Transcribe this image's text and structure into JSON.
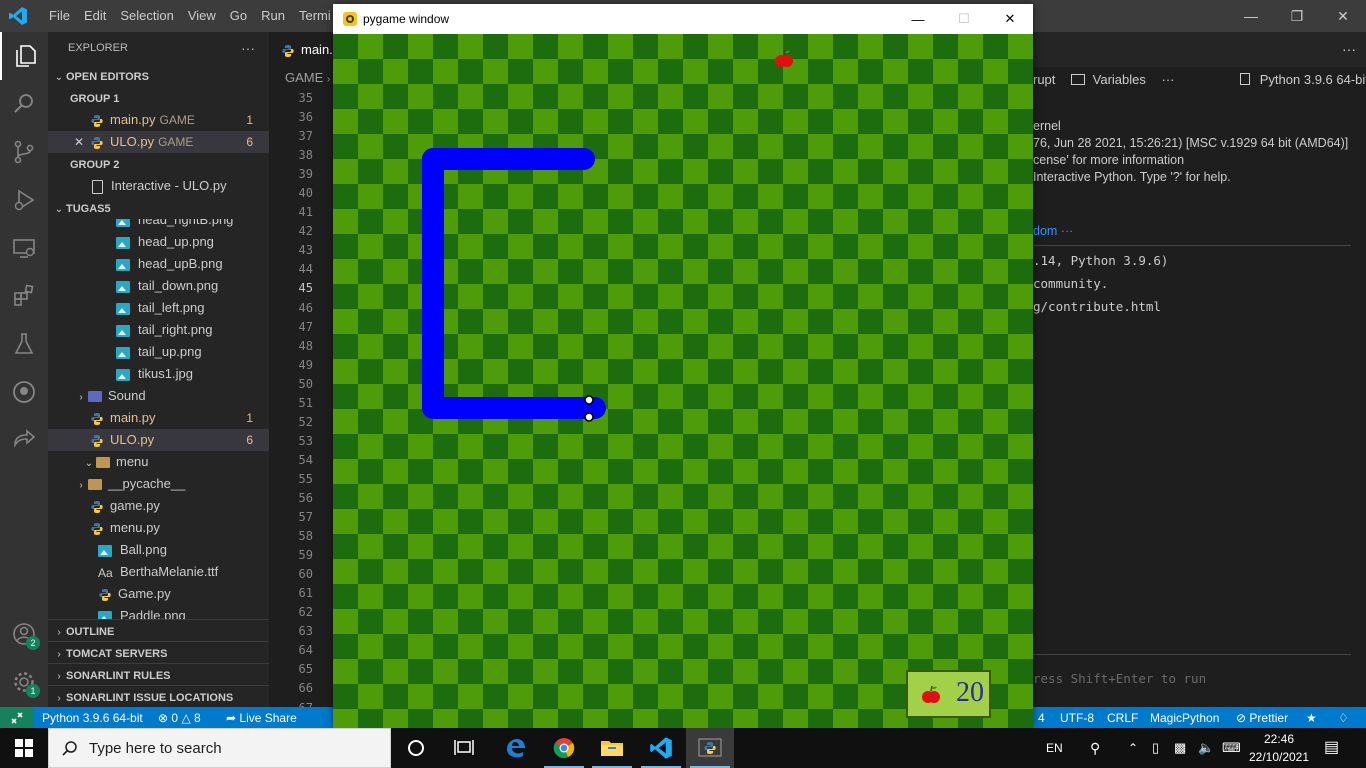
{
  "vscode": {
    "menu": [
      "File",
      "Edit",
      "Selection",
      "View",
      "Go",
      "Run",
      "Termi"
    ],
    "explorer_title": "EXPLORER",
    "open_editors": "OPEN EDITORS",
    "group1": "GROUP 1",
    "group2": "GROUP 2",
    "open_files": [
      {
        "name": "main.py",
        "desc": "GAME",
        "count": "1"
      },
      {
        "name": "ULO.py",
        "desc": "GAME",
        "count": "6"
      }
    ],
    "group2_file": "Interactive - ULO.py",
    "workspace": "TUGAS5",
    "tree": [
      {
        "name": "head_rightB.png",
        "type": "image",
        "indent": 1
      },
      {
        "name": "head_up.png",
        "type": "image",
        "indent": 1
      },
      {
        "name": "head_upB.png",
        "type": "image",
        "indent": 1
      },
      {
        "name": "tail_down.png",
        "type": "image",
        "indent": 1
      },
      {
        "name": "tail_left.png",
        "type": "image",
        "indent": 1
      },
      {
        "name": "tail_right.png",
        "type": "image",
        "indent": 1
      },
      {
        "name": "tail_up.png",
        "type": "image",
        "indent": 1
      },
      {
        "name": "tikus1.jpg",
        "type": "image",
        "indent": 1
      },
      {
        "name": "Sound",
        "type": "folder-closed",
        "indent": 0
      },
      {
        "name": "main.py",
        "type": "py",
        "indent": 0,
        "count": "1",
        "modified": true
      },
      {
        "name": "ULO.py",
        "type": "py",
        "indent": 0,
        "count": "6",
        "modified": true,
        "selected": true
      },
      {
        "name": "menu",
        "type": "folder-open",
        "indent": -1
      },
      {
        "name": "__pycache__",
        "type": "folder-closed",
        "indent": 0
      },
      {
        "name": "game.py",
        "type": "py",
        "indent": 0
      },
      {
        "name": "menu.py",
        "type": "py",
        "indent": 0
      },
      {
        "name": "Ball.png",
        "type": "image",
        "indent": -1
      },
      {
        "name": "BerthaMelanie.ttf",
        "type": "font",
        "indent": -1
      },
      {
        "name": "Game.py",
        "type": "py",
        "indent": -1
      },
      {
        "name": "Paddle.png",
        "type": "image",
        "indent": -1
      }
    ],
    "sections": [
      "OUTLINE",
      "TOMCAT SERVERS",
      "SONARLINT RULES",
      "SONARLINT ISSUE LOCATIONS"
    ],
    "tab_label": "main.",
    "breadcrumb": "GAME",
    "line_numbers": [
      "35",
      "36",
      "37",
      "38",
      "39",
      "40",
      "41",
      "42",
      "43",
      "44",
      "45",
      "46",
      "47",
      "48",
      "49",
      "50",
      "51",
      "52",
      "53",
      "54",
      "55",
      "56",
      "57",
      "58",
      "59",
      "60",
      "61",
      "62",
      "63",
      "64",
      "65",
      "66",
      "67"
    ],
    "current_line": "45",
    "right_panel": {
      "interrupt": "rupt",
      "variables": "Variables",
      "more": "···",
      "kernel": "Python 3.9.6 64-bit",
      "lines": [
        "ernel",
        "76, Jun 28 2021, 15:26:21) [MSC v.1929 64 bit (AMD64)]",
        "cense' for more information",
        " Interactive Python. Type '?' for help."
      ],
      "link": "dom ···",
      "mono_lines": [
        ".14, Python 3.9.6)",
        " community.",
        "g/contribute.html"
      ],
      "input_placeholder": "ress Shift+Enter to run"
    },
    "status": {
      "python": "Python 3.9.6 64-bit",
      "errors": "0",
      "warnings": "8",
      "liveshare": "Live Share",
      "spaces": "4",
      "encoding": "UTF-8",
      "eol": "CRLF",
      "language": "MagicPython",
      "prettier": "Prettier"
    },
    "badges": {
      "accounts": "2",
      "manage": "1"
    }
  },
  "pygame": {
    "title": "pygame window",
    "score": "20",
    "colors": {
      "grass_light": "#4e9c0a",
      "grass_dark": "#1d6d0e",
      "snake": "#0000ff",
      "score_bg": "#a2d149"
    }
  },
  "taskbar": {
    "search_placeholder": "Type here to search",
    "language": "EN",
    "time": "22:46",
    "date": "22/10/2021"
  }
}
